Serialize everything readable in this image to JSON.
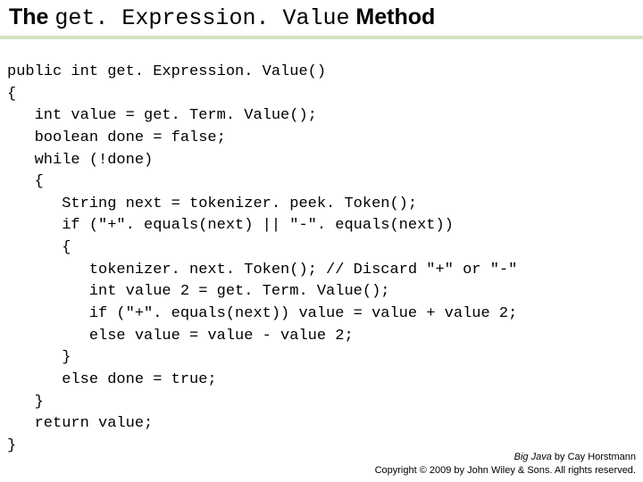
{
  "title": {
    "prefix": "The ",
    "method": "get. Expression. Value",
    "suffix": " Method"
  },
  "code": {
    "lines": [
      "public int get. Expression. Value()",
      "{",
      "   int value = get. Term. Value();",
      "   boolean done = false;",
      "   while (!done)",
      "   {",
      "      String next = tokenizer. peek. Token();",
      "      if (\"+\". equals(next) || \"-\". equals(next))",
      "      {",
      "         tokenizer. next. Token(); // Discard \"+\" or \"-\"",
      "         int value 2 = get. Term. Value();",
      "         if (\"+\". equals(next)) value = value + value 2;",
      "         else value = value - value 2;",
      "      }",
      "      else done = true;",
      "   }",
      "   return value;",
      "}"
    ]
  },
  "footer": {
    "book_title": "Big Java",
    "book_author": " by Cay Horstmann",
    "copyright": "Copyright © 2009 by John Wiley & Sons. All rights reserved."
  }
}
